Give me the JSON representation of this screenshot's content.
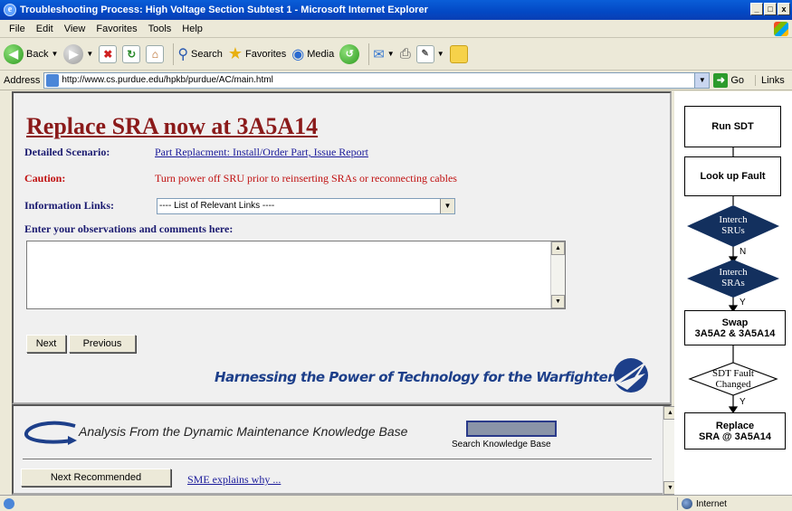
{
  "window": {
    "title": "Troubleshooting Process: High Voltage Section Subtest 1 - Microsoft Internet Explorer",
    "controls": [
      "_",
      "□",
      "x"
    ]
  },
  "menubar": [
    "File",
    "Edit",
    "View",
    "Favorites",
    "Tools",
    "Help"
  ],
  "toolbar": {
    "back": "Back",
    "search": "Search",
    "favorites": "Favorites",
    "media": "Media"
  },
  "addressbar": {
    "label": "Address",
    "url": "http://www.cs.purdue.edu/hpkb/purdue/AC/main.html",
    "go": "Go",
    "links": "Links"
  },
  "main": {
    "heading": "Replace SRA now at 3A5A14",
    "scenario_label": "Detailed Scenario:",
    "scenario_link": "Part Replacment: Install/Order Part, Issue Report",
    "caution_label": "Caution:",
    "caution_text": "Turn power off SRU prior to reinserting SRAs or reconnecting cables",
    "info_label": "Information Links:",
    "info_select_value": "---- List of Relevant Links ----",
    "comments_label": "Enter your observations and comments here:",
    "comments_value": "",
    "next_button": "Next",
    "previous_button": "Previous",
    "slogan": "Harnessing the Power of Technology for the Warfighter"
  },
  "lower": {
    "kb_title": "Analysis From the  Dynamic Maintenance Knowledge Base",
    "search_label": "Search Knowledge Base",
    "next_recommended": "Next Recommended",
    "sme_link": "SME explains why ..."
  },
  "flowchart": {
    "run_sdt": "Run SDT",
    "lookup": "Look up Fault",
    "d1_line1": "Interch",
    "d1_line2": "SRUs",
    "d1_branch": "N",
    "d2_line1": "Interch",
    "d2_line2": "SRAs",
    "d2_branch": "Y",
    "swap_line1": "Swap",
    "swap_line2": "3A5A2 & 3A5A14",
    "d3_line1": "SDT Fault",
    "d3_line2": "Changed",
    "d3_branch": "Y",
    "replace_line1": "Replace",
    "replace_line2": "SRA @ 3A5A14"
  },
  "statusbar": {
    "zone": "Internet"
  },
  "colors": {
    "heading": "#8b1a1a",
    "caution": "#c01010",
    "link": "#1a1a9a",
    "slogan": "#1d3f8a",
    "decision_fill": "#13305e"
  }
}
